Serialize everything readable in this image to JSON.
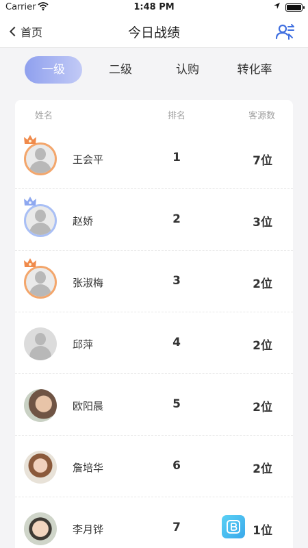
{
  "status": {
    "carrier": "Carrier",
    "time": "1:48 PM",
    "battery_percent": 100
  },
  "nav": {
    "back_label": "首页",
    "title": "今日战绩",
    "action_icon": "people-switch-icon"
  },
  "tabs": [
    {
      "label": "一级",
      "active": true
    },
    {
      "label": "二级",
      "active": false
    },
    {
      "label": "认购",
      "active": false
    },
    {
      "label": "转化率",
      "active": false
    }
  ],
  "table": {
    "columns": [
      "姓名",
      "排名",
      "客源数"
    ],
    "rows": [
      {
        "name": "王会平",
        "rank": "1",
        "sources": "7位",
        "avatar": "default",
        "badge": "orange-crown"
      },
      {
        "name": "赵娇",
        "rank": "2",
        "sources": "3位",
        "avatar": "default",
        "badge": "blue-crown"
      },
      {
        "name": "张淑梅",
        "rank": "3",
        "sources": "2位",
        "avatar": "default",
        "badge": "orange-crown"
      },
      {
        "name": "邱萍",
        "rank": "4",
        "sources": "2位",
        "avatar": "default",
        "badge": "none"
      },
      {
        "name": "欧阳晨",
        "rank": "5",
        "sources": "2位",
        "avatar": "photo",
        "badge": "none"
      },
      {
        "name": "詹培华",
        "rank": "6",
        "sources": "2位",
        "avatar": "photo",
        "badge": "none"
      },
      {
        "name": "李月铧",
        "rank": "7",
        "sources": "1位",
        "avatar": "photo",
        "badge": "none"
      }
    ]
  },
  "colors": {
    "accent_gradient_start": "#8fa0ee",
    "accent_gradient_end": "#c2caf6",
    "crown_orange": "#f08a4b",
    "crown_blue": "#8ea8f0",
    "icon_blue": "#3f6fe0"
  }
}
